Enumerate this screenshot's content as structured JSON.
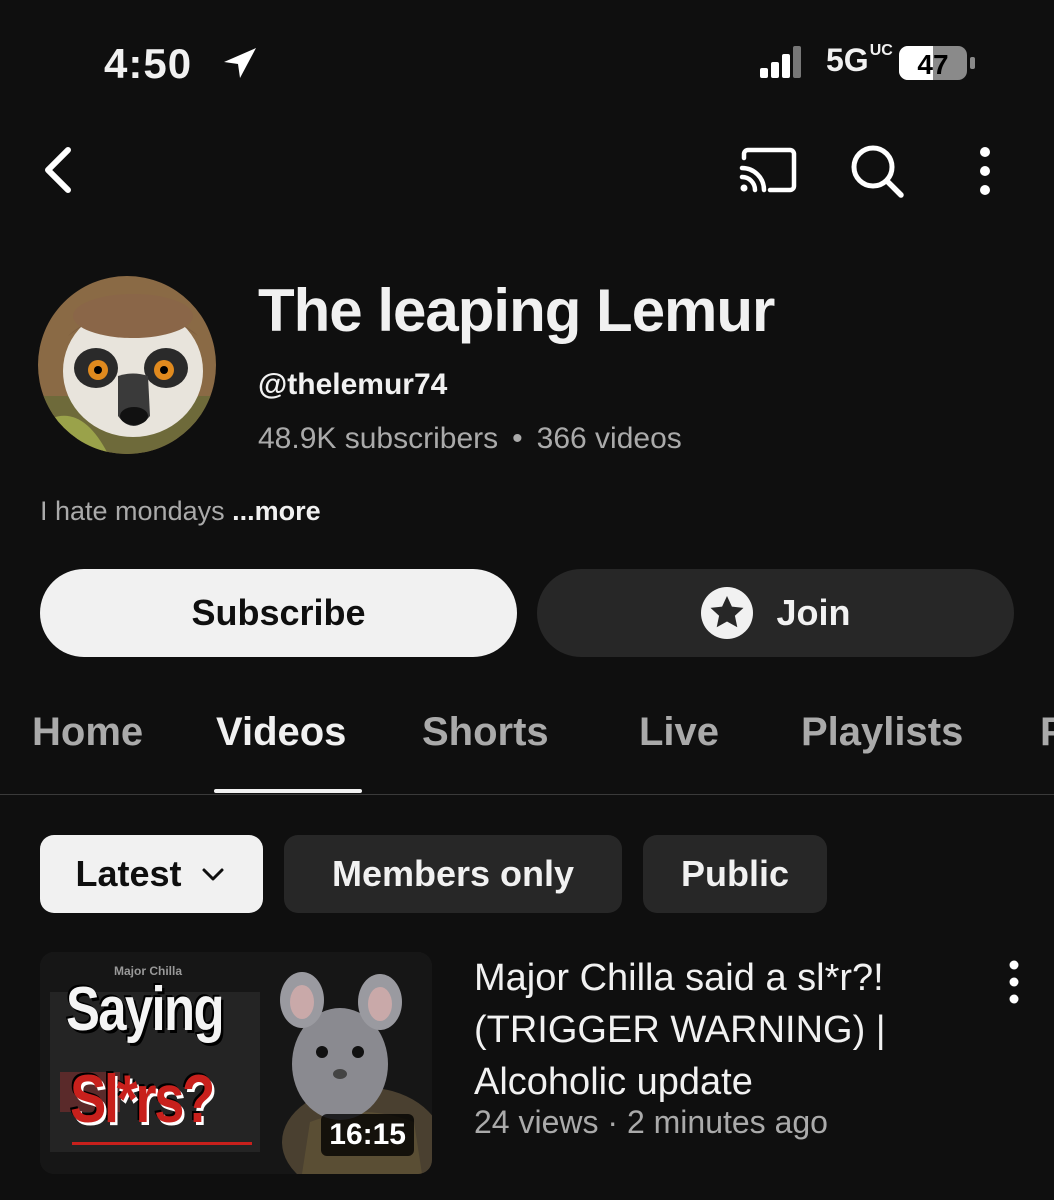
{
  "status_bar": {
    "time": "4:50",
    "network": "5G",
    "network_sup": "UC",
    "battery": "47"
  },
  "top_bar": {
    "icons": [
      "back-icon",
      "cast-icon",
      "search-icon",
      "more-vert-icon"
    ]
  },
  "channel": {
    "name": "The leaping Lemur",
    "handle": "@thelemur74",
    "subscribers": "48.9K subscribers",
    "separator": "•",
    "videos": "366 videos",
    "description": "I hate mondays",
    "more_label": "...more"
  },
  "actions": {
    "subscribe_label": "Subscribe",
    "join_label": "Join"
  },
  "tabs": [
    {
      "label": "Home"
    },
    {
      "label": "Videos"
    },
    {
      "label": "Shorts"
    },
    {
      "label": "Live"
    },
    {
      "label": "Playlists"
    },
    {
      "label": "P"
    }
  ],
  "active_tab": "Videos",
  "chips": {
    "sort_label": "Latest",
    "members_label": "Members only",
    "public_label": "Public"
  },
  "video": {
    "thumb_small_text": "Major Chilla",
    "thumb_line1": "Saying",
    "thumb_line2": "Sl*rs?",
    "duration": "16:15",
    "title": "Major Chilla said a sl*r?! (TRIGGER WARNING) | Alcoholic update",
    "meta": "24 views · 2 minutes ago"
  },
  "colors": {
    "background": "#0f0f0f",
    "text": "#f1f1f1",
    "secondary_text": "#aaaaaa",
    "chip_dark": "#272727",
    "thumb_red": "#c8201c"
  }
}
